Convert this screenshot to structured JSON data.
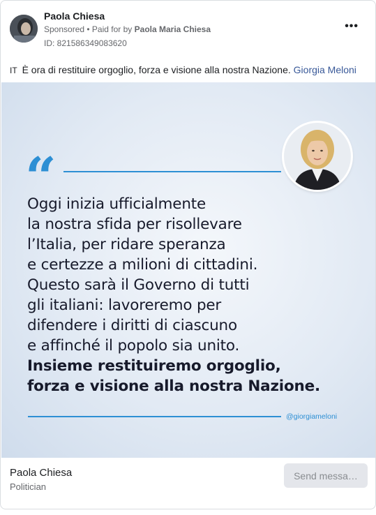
{
  "post": {
    "author": "Paola Chiesa",
    "sponsored": "Sponsored",
    "paid_for_prefix": "• Paid for by",
    "payer": "Paola Maria Chiesa",
    "ad_id": "ID: 821586349083620",
    "more_label": "•••"
  },
  "caption": {
    "language_tag": "IT",
    "text": "È ora di restituire orgoglio, forza e visione alla nostra Nazione.",
    "link": "Giorgia Meloni"
  },
  "creative": {
    "quote_mark": "“",
    "lines": [
      "Oggi inizia ufficialmente",
      "la nostra sfida per risollevare",
      "l’Italia, per ridare speranza",
      "e certezze a milioni di cittadini.",
      "Questo sarà il Governo di tutti",
      "gli italiani: lavoreremo per",
      "difendere i diritti di ciascuno",
      "e affinché il popolo sia unito."
    ],
    "bold_lines": [
      "Insieme restituiremo orgoglio,",
      "forza e visione alla nostra Nazione."
    ],
    "handle": "@giorgiameloni",
    "accent_color": "#2d8fd4"
  },
  "footer": {
    "page_name": "Paola Chiesa",
    "category": "Politician",
    "button_label": "Send messa…"
  }
}
